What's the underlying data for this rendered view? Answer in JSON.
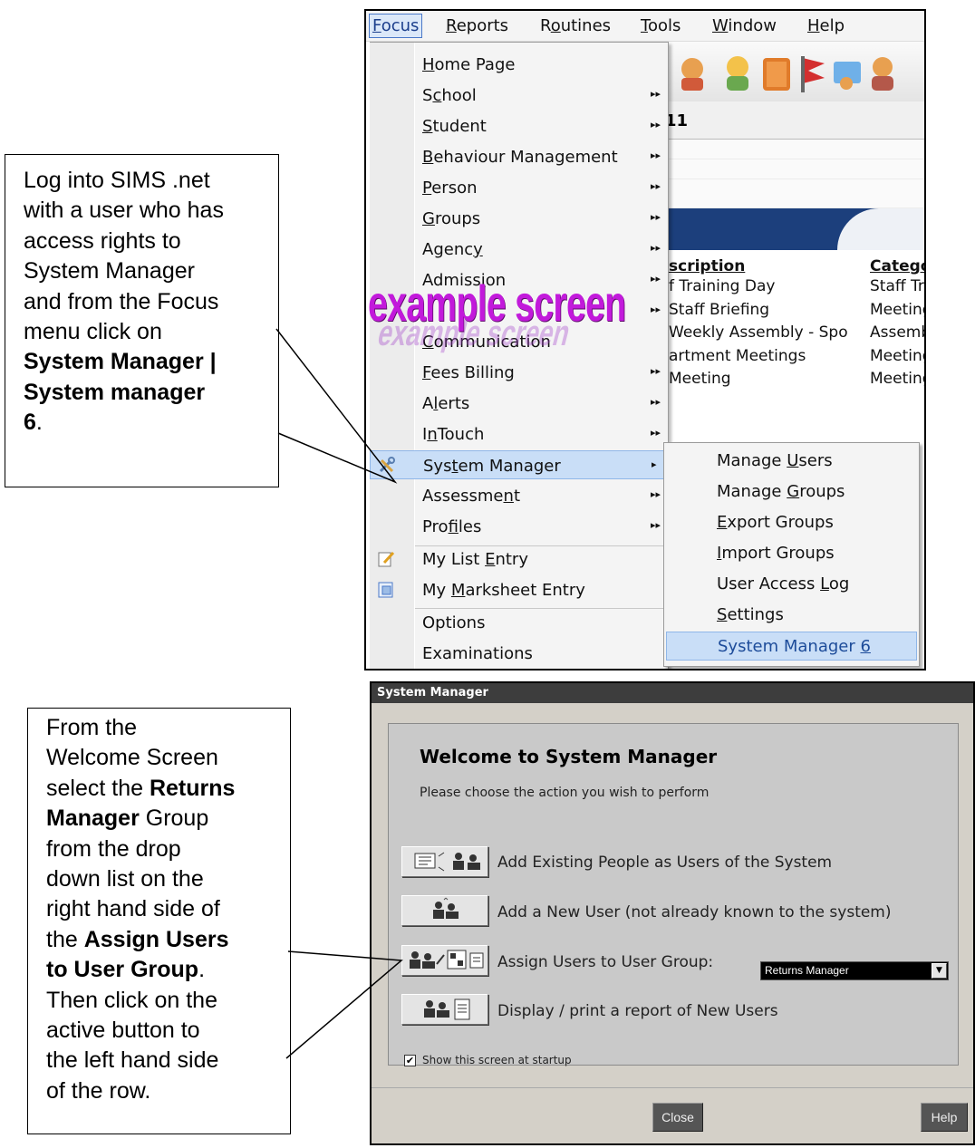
{
  "callout1": {
    "lines": [
      [
        {
          "t": "Log into SIMS .net"
        }
      ],
      [
        {
          "t": "with a user who has"
        }
      ],
      [
        {
          "t": "access rights to"
        }
      ],
      [
        {
          "t": "System Manager"
        }
      ],
      [
        {
          "t": "and from the Focus"
        }
      ],
      [
        {
          "t": "menu click on"
        }
      ],
      [
        {
          "t": "System Manager |",
          "b": true
        }
      ],
      [
        {
          "t": "System manager",
          "b": true
        }
      ],
      [
        {
          "t": "6",
          "b": true
        },
        {
          "t": "."
        }
      ]
    ]
  },
  "callout2": {
    "lines": [
      [
        {
          "t": "From the"
        }
      ],
      [
        {
          "t": "Welcome Screen"
        }
      ],
      [
        {
          "t": "select the "
        },
        {
          "t": "Returns",
          "b": true
        }
      ],
      [
        {
          "t": "Manager",
          "b": true
        },
        {
          "t": " Group"
        }
      ],
      [
        {
          "t": "from the drop"
        }
      ],
      [
        {
          "t": "down list on the"
        }
      ],
      [
        {
          "t": "right hand side of"
        }
      ],
      [
        {
          "t": "the "
        },
        {
          "t": "Assign Users",
          "b": true
        }
      ],
      [
        {
          "t": "to User Group",
          "b": true
        },
        {
          "t": "."
        }
      ],
      [
        {
          "t": "Then click on the"
        }
      ],
      [
        {
          "t": "active button to"
        }
      ],
      [
        {
          "t": "the left hand side"
        }
      ],
      [
        {
          "t": "of the row."
        }
      ]
    ]
  },
  "menubar": [
    {
      "pre": "",
      "u": "F",
      "post": "ocus"
    },
    {
      "pre": "",
      "u": "R",
      "post": "eports"
    },
    {
      "pre": "R",
      "u": "o",
      "post": "utines"
    },
    {
      "pre": "",
      "u": "T",
      "post": "ools"
    },
    {
      "pre": "",
      "u": "W",
      "post": "indow"
    },
    {
      "pre": "",
      "u": "H",
      "post": "elp"
    }
  ],
  "focus_menu": [
    {
      "pre": "",
      "u": "H",
      "post": "ome Page",
      "arrow": false
    },
    {
      "pre": "S",
      "u": "c",
      "post": "hool",
      "arrow": true
    },
    {
      "pre": "",
      "u": "S",
      "post": "tudent",
      "arrow": true
    },
    {
      "pre": "",
      "u": "B",
      "post": "ehaviour Management",
      "arrow": true
    },
    {
      "pre": "",
      "u": "P",
      "post": "erson",
      "arrow": true
    },
    {
      "pre": "",
      "u": "G",
      "post": "roups",
      "arrow": true
    },
    {
      "pre": "Agenc",
      "u": "y",
      "post": "",
      "arrow": true
    },
    {
      "pre": "Admiss",
      "u": "i",
      "post": "on",
      "arrow": true
    },
    {
      "pre": "",
      "u": "",
      "post": "",
      "arrow": true
    },
    {
      "pre": "",
      "u": "C",
      "post": "ommunication",
      "arrow": false
    },
    {
      "pre": "",
      "u": "F",
      "post": "ees Billing",
      "arrow": true
    },
    {
      "pre": "A",
      "u": "l",
      "post": "erts",
      "arrow": true
    },
    {
      "pre": "I",
      "u": "n",
      "post": "Touch",
      "arrow": true
    },
    {
      "pre": "Sys",
      "u": "t",
      "post": "em Manager",
      "arrow": true
    },
    {
      "pre": "Assessme",
      "u": "n",
      "post": "t",
      "arrow": true
    },
    {
      "pre": "Pro",
      "u": "f",
      "post": "iles",
      "arrow": true
    },
    {
      "pre": "My List ",
      "u": "E",
      "post": "ntry",
      "arrow": false
    },
    {
      "pre": "My ",
      "u": "M",
      "post": "arksheet Entry",
      "arrow": false
    },
    {
      "pre": "Options",
      "u": "",
      "post": "",
      "arrow": false
    },
    {
      "pre": "Examinations",
      "u": "",
      "post": "",
      "arrow": false
    }
  ],
  "submenu": [
    {
      "pre": "Manage ",
      "u": "U",
      "post": "sers"
    },
    {
      "pre": "Manage ",
      "u": "G",
      "post": "roups"
    },
    {
      "pre": "",
      "u": "E",
      "post": "xport Groups"
    },
    {
      "pre": "",
      "u": "I",
      "post": "mport Groups"
    },
    {
      "pre": "User Access ",
      "u": "L",
      "post": "og"
    },
    {
      "pre": "",
      "u": "S",
      "post": "ettings"
    },
    {
      "pre": "System Manager ",
      "u": "6",
      "post": ""
    }
  ],
  "bg": {
    "title_frag": "11",
    "table_head": [
      "scription",
      "Catego"
    ],
    "table_rows": [
      [
        "f Training Day",
        "Staff Tra"
      ],
      [
        " Staff Briefing",
        "Meeting"
      ],
      [
        " Weekly Assembly - Spo",
        "Assemb"
      ],
      [
        "artment Meetings",
        "Meeting"
      ],
      [
        "  Meeting",
        "Meeting"
      ]
    ]
  },
  "watermark": "example screen",
  "dialog": {
    "title": "System Manager",
    "heading": "Welcome to System Manager",
    "subheading": "Please choose the action you wish to perform",
    "actions": [
      "Add Existing People as Users of the System",
      "Add a New User (not already  known to the system)",
      "Assign Users to User Group:",
      "Display / print a report of New Users"
    ],
    "group_selected": "Returns Manager",
    "startup_label": "Show this screen at startup",
    "startup_checked": "✔",
    "close_label": "Close",
    "help_label": "Help"
  }
}
